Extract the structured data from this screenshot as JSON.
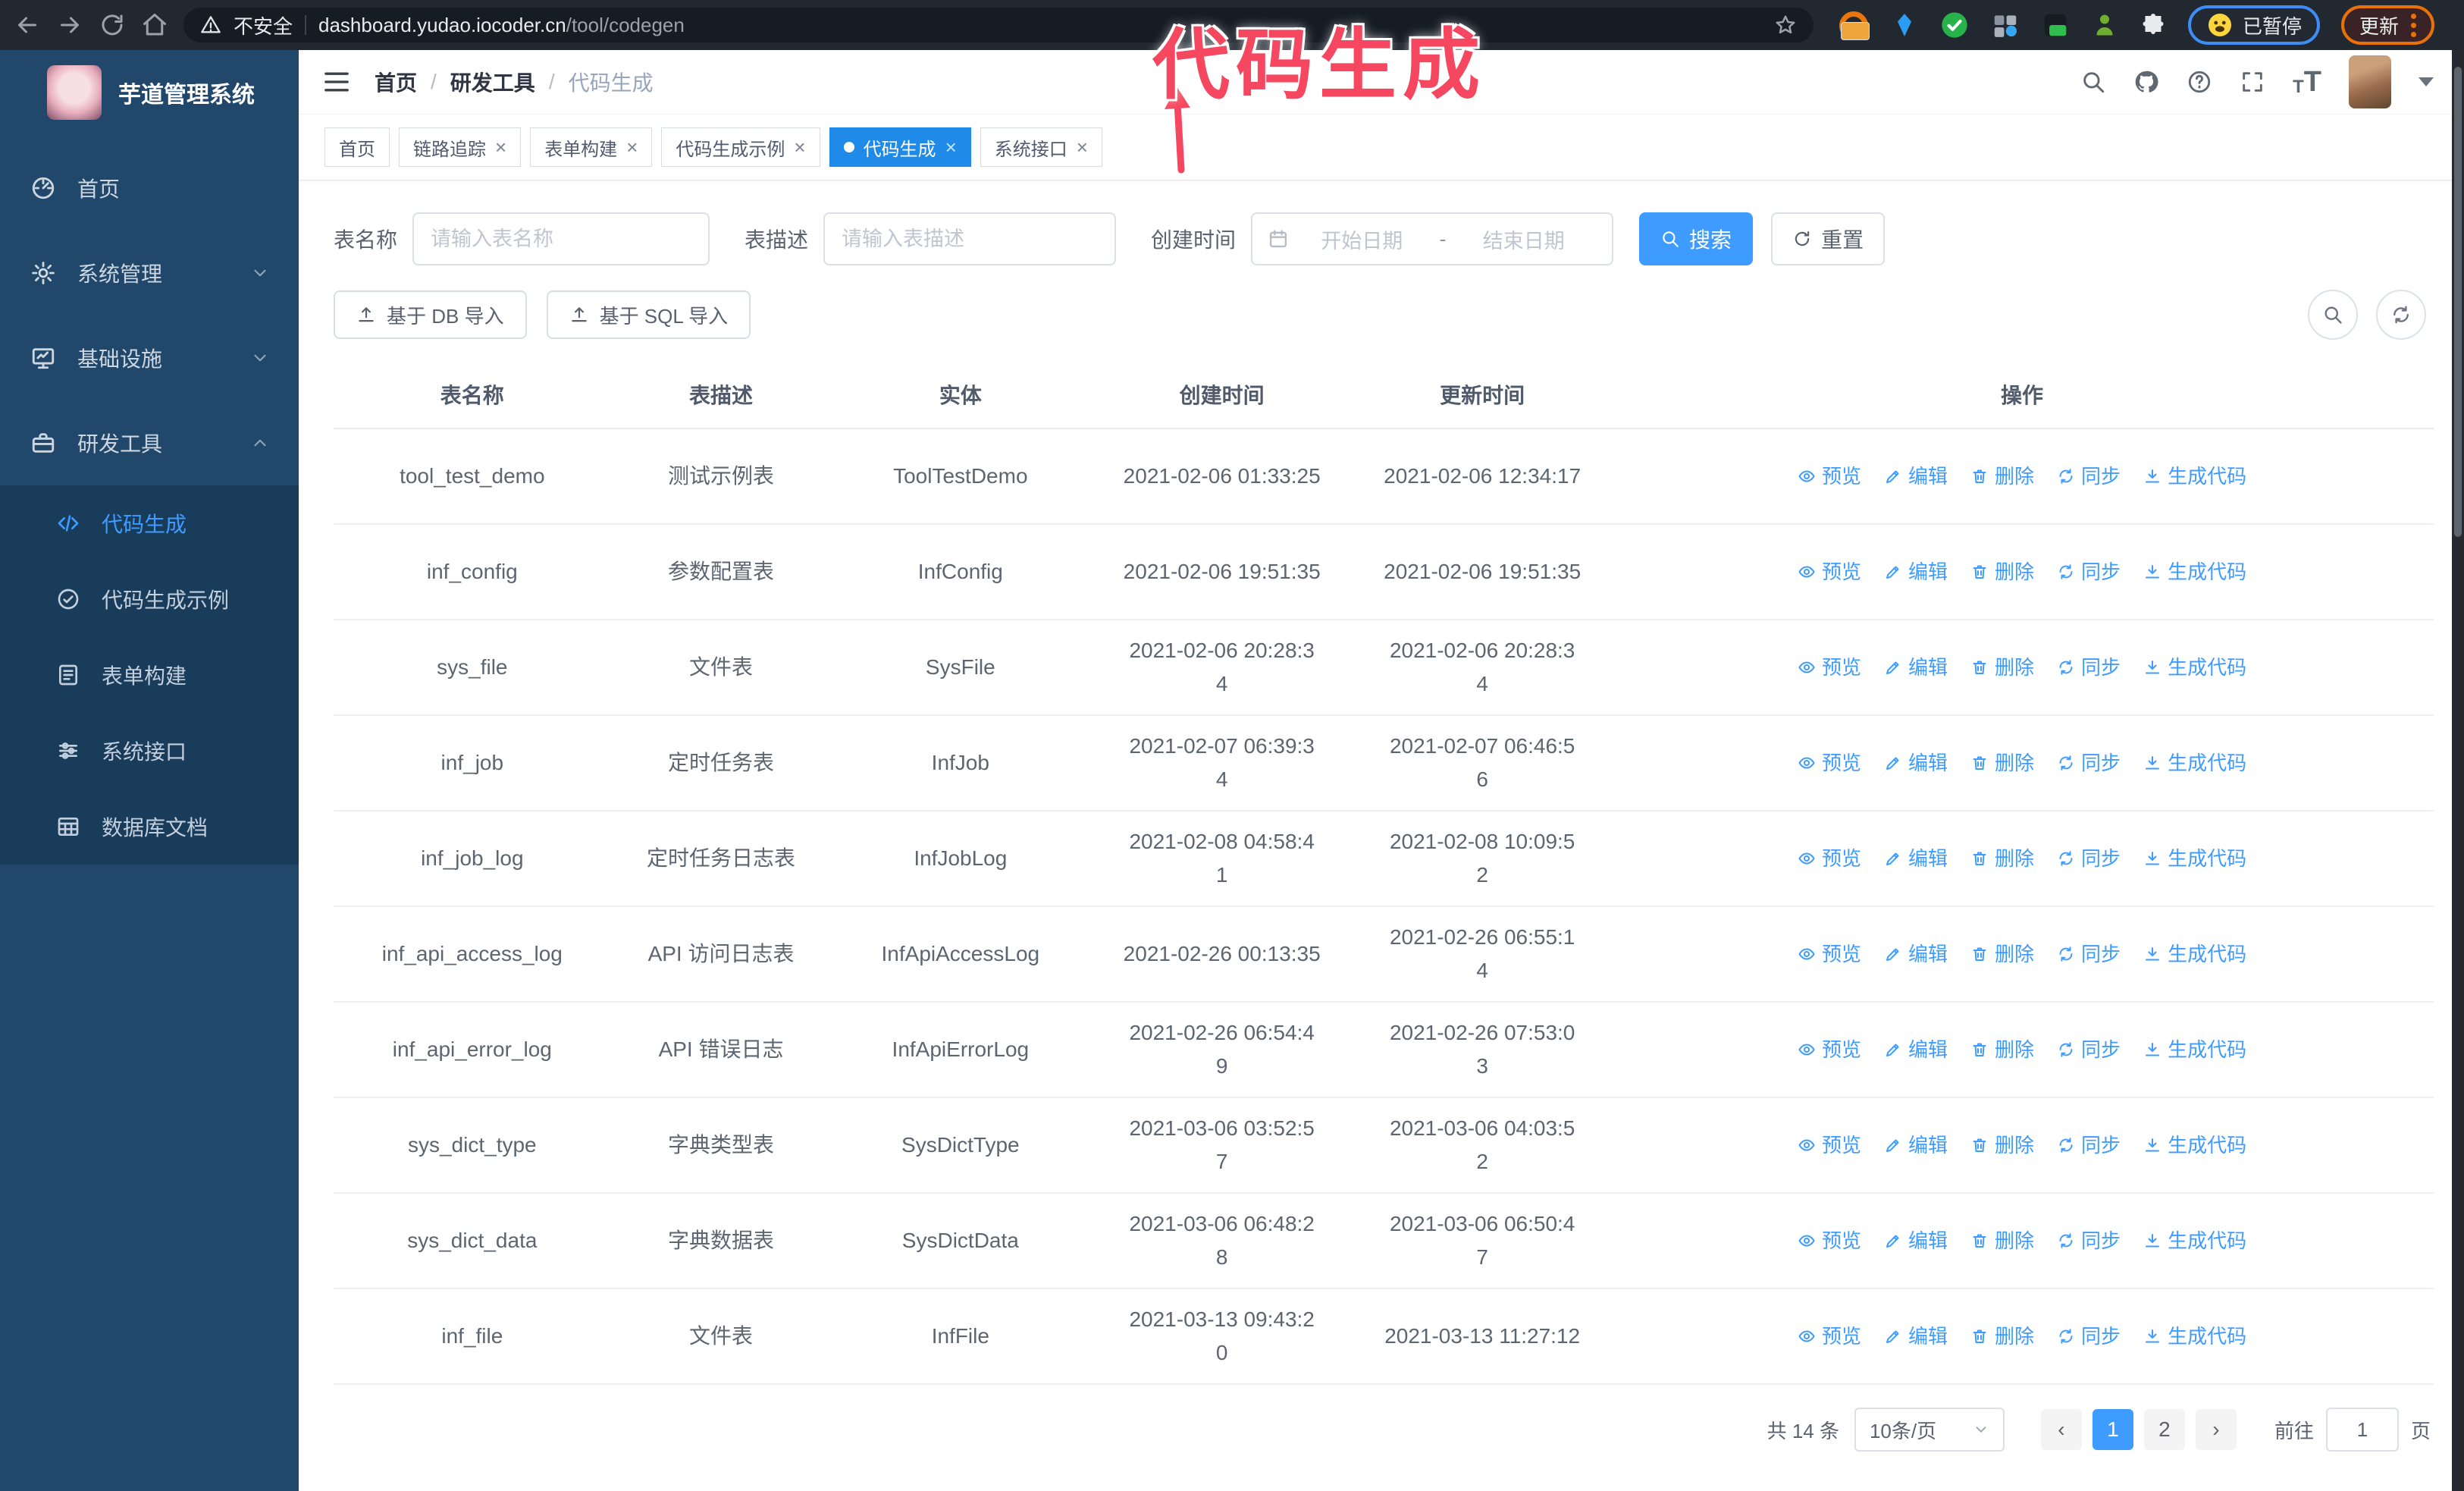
{
  "ui": {
    "close_glyph": "×",
    "prev_glyph": "‹",
    "next_glyph": "›",
    "breadcrumb_separator": "/"
  },
  "browser": {
    "security_label": "不安全",
    "url_host": "dashboard.yudao.iocoder.cn",
    "url_path": "/tool/codegen",
    "paused_badge": "已暂停",
    "update_badge": "更新"
  },
  "annotation": {
    "text": "代码生成",
    "color": "#f5475f"
  },
  "sidebar": {
    "app_title": "芋道管理系统",
    "items": [
      {
        "label": "首页"
      },
      {
        "label": "系统管理"
      },
      {
        "label": "基础设施"
      },
      {
        "label": "研发工具"
      }
    ],
    "subitems": [
      {
        "label": "代码生成",
        "active": true
      },
      {
        "label": "代码生成示例"
      },
      {
        "label": "表单构建"
      },
      {
        "label": "系统接口"
      },
      {
        "label": "数据库文档"
      }
    ]
  },
  "header": {
    "breadcrumb": [
      "首页",
      "研发工具",
      "代码生成"
    ]
  },
  "tabs": [
    {
      "label": "首页"
    },
    {
      "label": "链路追踪",
      "closable": true
    },
    {
      "label": "表单构建",
      "closable": true
    },
    {
      "label": "代码生成示例",
      "closable": true
    },
    {
      "label": "代码生成",
      "closable": true,
      "active": true
    },
    {
      "label": "系统接口",
      "closable": true
    }
  ],
  "filters": {
    "table_name_label": "表名称",
    "table_name_placeholder": "请输入表名称",
    "table_desc_label": "表描述",
    "table_desc_placeholder": "请输入表描述",
    "create_time_label": "创建时间",
    "date_start_placeholder": "开始日期",
    "date_separator": "-",
    "date_end_placeholder": "结束日期",
    "search_button": "搜索",
    "reset_button": "重置"
  },
  "toolbar": {
    "import_db_button": "基于 DB 导入",
    "import_sql_button": "基于 SQL 导入"
  },
  "table": {
    "columns": [
      "表名称",
      "表描述",
      "实体",
      "创建时间",
      "更新时间",
      "操作"
    ],
    "actions": [
      {
        "label": "预览"
      },
      {
        "label": "编辑"
      },
      {
        "label": "删除"
      },
      {
        "label": "同步"
      },
      {
        "label": "生成代码"
      }
    ],
    "rows": [
      {
        "name": "tool_test_demo",
        "desc": "测试示例表",
        "entity": "ToolTestDemo",
        "created": "2021-02-06 01:33:25",
        "updated": "2021-02-06 12:34:17"
      },
      {
        "name": "inf_config",
        "desc": "参数配置表",
        "entity": "InfConfig",
        "created": "2021-02-06 19:51:35",
        "updated": "2021-02-06 19:51:35"
      },
      {
        "name": "sys_file",
        "desc": "文件表",
        "entity": "SysFile",
        "created": "2021-02-06 20:28:3\n4",
        "updated": "2021-02-06 20:28:3\n4"
      },
      {
        "name": "inf_job",
        "desc": "定时任务表",
        "entity": "InfJob",
        "created": "2021-02-07 06:39:3\n4",
        "updated": "2021-02-07 06:46:5\n6"
      },
      {
        "name": "inf_job_log",
        "desc": "定时任务日志表",
        "entity": "InfJobLog",
        "created": "2021-02-08 04:58:4\n1",
        "updated": "2021-02-08 10:09:5\n2"
      },
      {
        "name": "inf_api_access_log",
        "desc": "API 访问日志表",
        "entity": "InfApiAccessLog",
        "created": "2021-02-26 00:13:35",
        "updated": "2021-02-26 06:55:1\n4"
      },
      {
        "name": "inf_api_error_log",
        "desc": "API 错误日志",
        "entity": "InfApiErrorLog",
        "created": "2021-02-26 06:54:4\n9",
        "updated": "2021-02-26 07:53:0\n3"
      },
      {
        "name": "sys_dict_type",
        "desc": "字典类型表",
        "entity": "SysDictType",
        "created": "2021-03-06 03:52:5\n7",
        "updated": "2021-03-06 04:03:5\n2"
      },
      {
        "name": "sys_dict_data",
        "desc": "字典数据表",
        "entity": "SysDictData",
        "created": "2021-03-06 06:48:2\n8",
        "updated": "2021-03-06 06:50:4\n7"
      },
      {
        "name": "inf_file",
        "desc": "文件表",
        "entity": "InfFile",
        "created": "2021-03-13 09:43:2\n0",
        "updated": "2021-03-13 11:27:12"
      }
    ]
  },
  "pagination": {
    "total": "共 14 条",
    "page_size": "10条/页",
    "pages": [
      {
        "label": "1",
        "active": true
      },
      {
        "label": "2"
      }
    ],
    "goto_label": "前往",
    "goto_value": "1",
    "page_suffix": "页"
  }
}
